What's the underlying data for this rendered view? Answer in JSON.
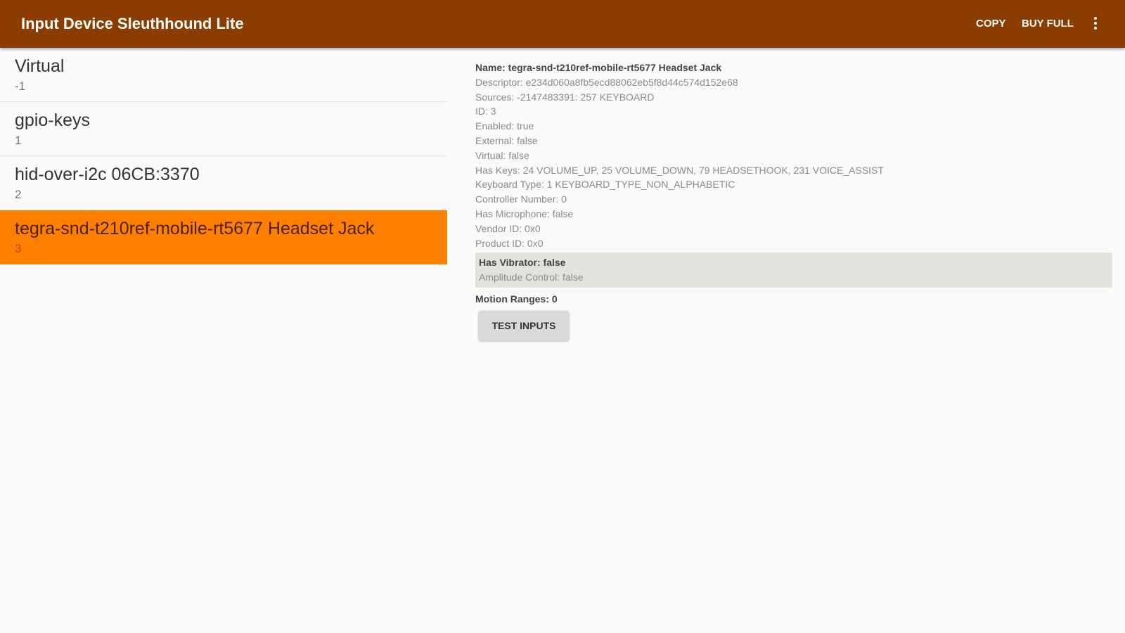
{
  "appbar": {
    "title": "Input Device Sleuthhound Lite",
    "actions": {
      "copy_label": "COPY",
      "buy_label": "BUY FULL"
    },
    "overflow_icon": "more-vert-icon",
    "background_color": "#8b3d00"
  },
  "devices": [
    {
      "name": "Virtual",
      "id": "-1",
      "selected": false
    },
    {
      "name": "gpio-keys",
      "id": "1",
      "selected": false
    },
    {
      "name": "hid-over-i2c 06CB:3370",
      "id": "2",
      "selected": false
    },
    {
      "name": "tegra-snd-t210ref-mobile-rt5677 Headset Jack",
      "id": "3",
      "selected": true
    }
  ],
  "selected_color": "#ff8000",
  "details": {
    "name": "Name: tegra-snd-t210ref-mobile-rt5677 Headset Jack",
    "lines": [
      "Descriptor: e234d060a8fb5ecd88062eb5f8d44c574d152e68",
      "Sources: -2147483391: 257 KEYBOARD",
      "ID: 3",
      "Enabled: true",
      "External: false",
      "Virtual: false",
      "Has Keys: 24 VOLUME_UP, 25 VOLUME_DOWN, 79 HEADSETHOOK, 231 VOICE_ASSIST",
      "Keyboard Type: 1 KEYBOARD_TYPE_NON_ALPHABETIC",
      "Controller Number: 0",
      "Has Microphone: false",
      "Vendor ID: 0x0",
      "Product ID: 0x0"
    ],
    "vibrator": {
      "has_vibrator": "Has Vibrator: false",
      "amplitude_control": "Amplitude Control: false"
    },
    "motion_ranges": "Motion Ranges: 0",
    "test_button_label": "TEST INPUTS"
  }
}
